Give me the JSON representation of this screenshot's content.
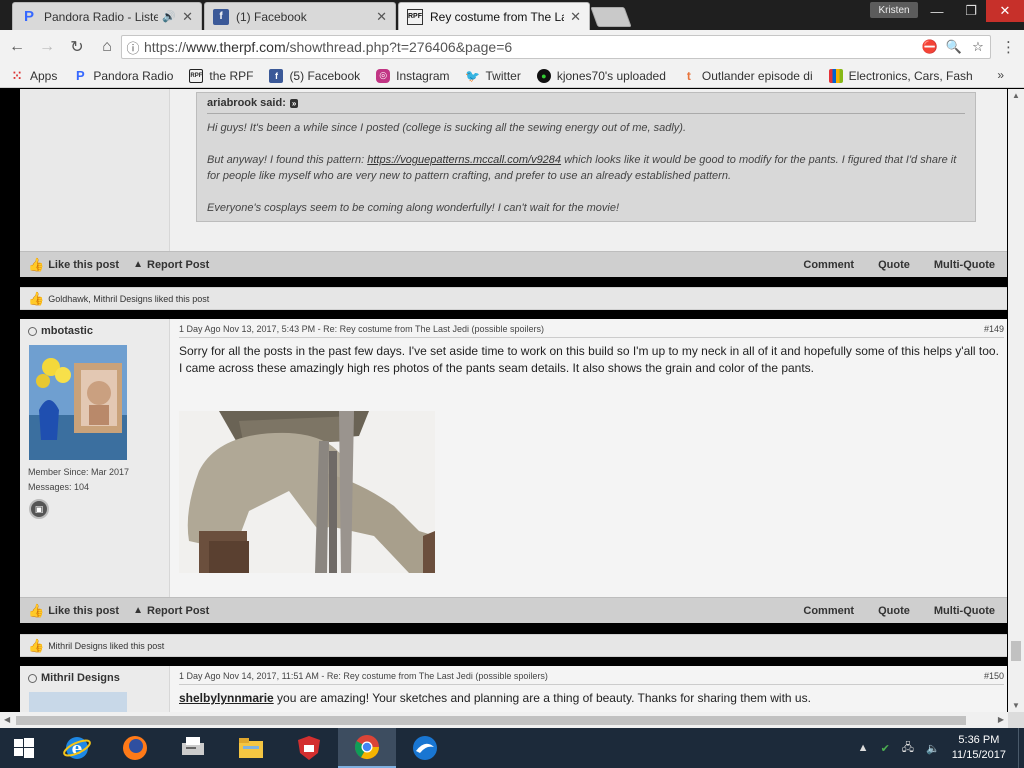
{
  "browser": {
    "tabs": [
      {
        "title": "Pandora Radio - Listen",
        "favicon": "pandora-icon"
      },
      {
        "title": "(1) Facebook",
        "favicon": "facebook-icon"
      },
      {
        "title": "Rey costume from The La",
        "favicon": "rpf-icon"
      }
    ],
    "profile_name": "Kristen",
    "url_prefix": "https://",
    "url_host": "www.therpf.com",
    "url_path": "/showthread.php?t=276406&page=6",
    "bookmarks": [
      {
        "label": "Apps",
        "icon": "apps-icon"
      },
      {
        "label": "Pandora Radio",
        "icon": "pandora-icon"
      },
      {
        "label": "the RPF",
        "icon": "rpf-icon"
      },
      {
        "label": "(5) Facebook",
        "icon": "facebook-icon"
      },
      {
        "label": "Instagram",
        "icon": "instagram-icon"
      },
      {
        "label": "Twitter",
        "icon": "twitter-icon"
      },
      {
        "label": "kjones70's uploaded",
        "icon": "green-circle-icon"
      },
      {
        "label": "Outlander episode di",
        "icon": "tumblr-icon"
      },
      {
        "label": "Electronics, Cars, Fash",
        "icon": "ebay-icon"
      }
    ],
    "bookmarks_more": "»"
  },
  "quote": {
    "author": "ariabrook said:",
    "p1": "Hi guys! It's been a while since I posted (college is sucking all the sewing energy out of me, sadly).",
    "p2_before": "But anyway! I found this pattern: ",
    "p2_link": "https://voguepatterns.mccall.com/v9284",
    "p2_after": " which looks like it would be good to modify for the pants. I figured that I'd share it for people like myself who are very new to pattern crafting, and prefer to use an already established pattern.",
    "p3": "Everyone's cosplays seem to be coming along wonderfully! I can't wait for the movie!"
  },
  "actions": {
    "like": "Like this post",
    "report": "Report Post",
    "comment": "Comment",
    "quote": "Quote",
    "multiquote": "Multi-Quote"
  },
  "liked1": "Goldhawk, Mithril Designs liked this post",
  "post149": {
    "username": "mbotastic",
    "member_since": "Member Since: Mar 2017",
    "messages": "Messages: 104",
    "meta": "1 Day Ago  Nov 13, 2017, 5:43 PM - Re: Rey costume from The Last Jedi (possible spoilers)",
    "number": "#149",
    "body": "Sorry for all the posts in the past few days. I've set aside time to work on this build so I'm up to my neck in all of it and hopefully some of this helps y'all too. I came across these amazingly high res photos of the pants seam details. It also shows the grain and color of the pants."
  },
  "liked2": "Mithril Designs liked this post",
  "post150": {
    "username": "Mithril Designs",
    "meta": "1 Day Ago  Nov 14, 2017, 11:51 AM - Re: Rey costume from The Last Jedi (possible spoilers)",
    "number": "#150",
    "mention": "shelbylynnmarie",
    "body": " you are amazing! Your sketches and planning are a thing of beauty. Thanks for sharing them with us."
  },
  "taskbar": {
    "time": "5:36 PM",
    "date": "11/15/2017"
  },
  "colors": {
    "pandora": "#3668ff",
    "facebook": "#3b5998",
    "twitter": "#1da1f2",
    "accent_close": "#c7302a"
  }
}
